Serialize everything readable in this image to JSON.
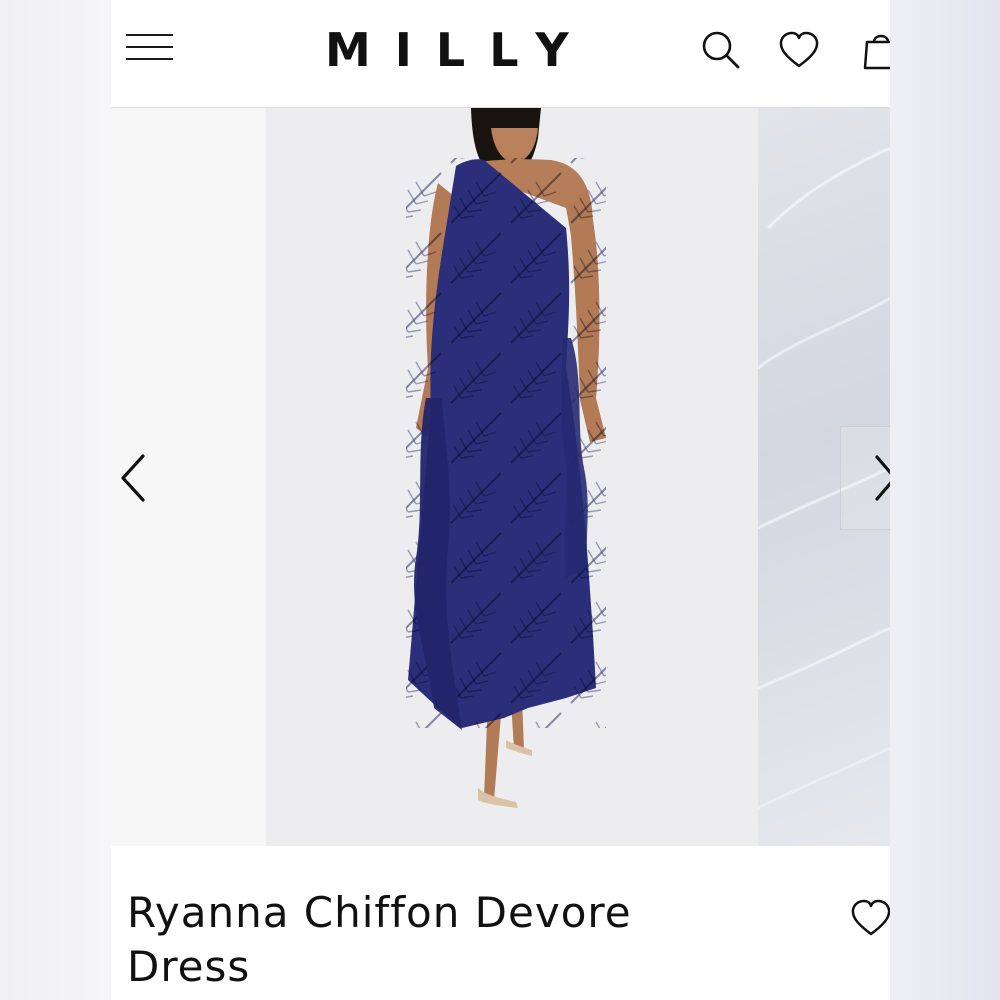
{
  "header": {
    "brand": "MILLY",
    "icons": [
      "menu-icon",
      "search-icon",
      "heart-icon",
      "shopping-bag-icon"
    ]
  },
  "product": {
    "title_line1": "Ryanna Chiffon Devore",
    "title_line2": "Dress",
    "dress_color": "#2b2f7a"
  },
  "carousel": {
    "prev_icon": "chevron-left-icon",
    "next_icon": "chevron-right-icon"
  },
  "colors": {
    "text": "#111111",
    "background": "#ffffff",
    "image_background": "#ededf0"
  }
}
